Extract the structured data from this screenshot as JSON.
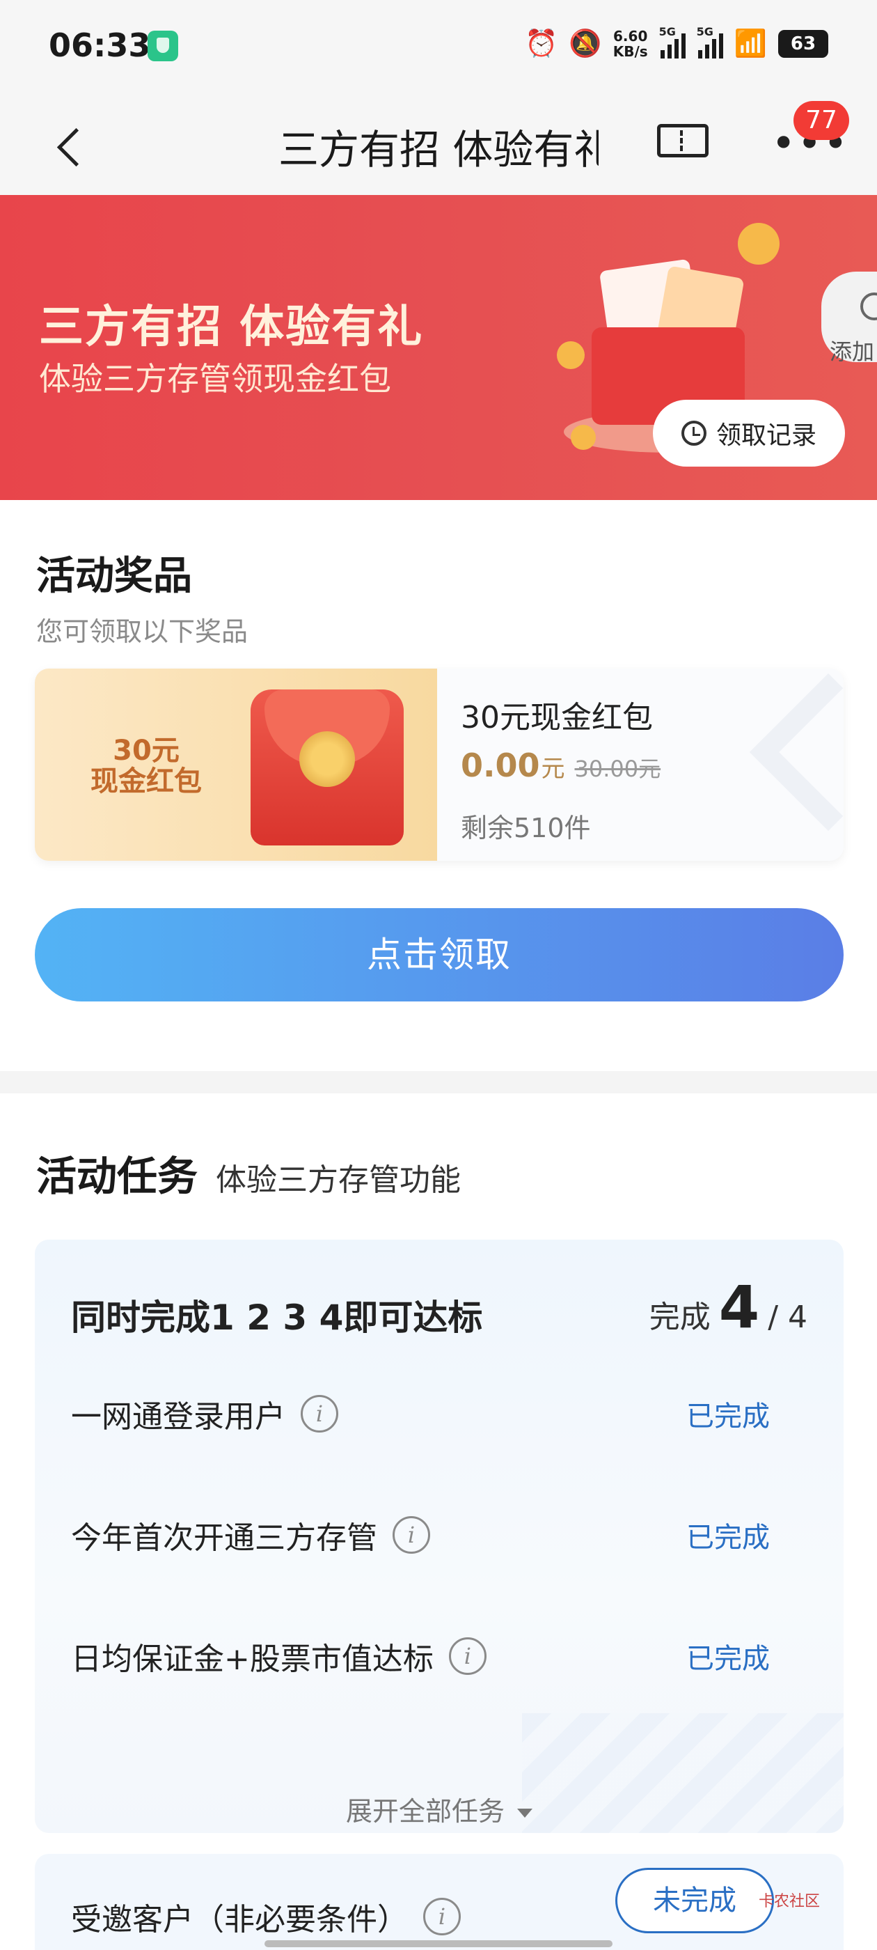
{
  "status_bar": {
    "time": "06:33",
    "speed_value": "6.60",
    "speed_unit": "KB/s",
    "sig1_label": "5G",
    "sig2_label": "5G",
    "battery": "63",
    "icons": [
      "alarm-icon",
      "mute-icon",
      "signal-icon",
      "signal-icon",
      "wifi-icon",
      "battery-icon"
    ]
  },
  "header": {
    "title": "三方有招 体验有礼",
    "badge_count": "77"
  },
  "banner": {
    "title": "三方有招 体验有礼",
    "subtitle": "体验三方存管领现金红包",
    "add_label": "添加",
    "record_label": "领取记录"
  },
  "prizes": {
    "title": "活动奖品",
    "subtitle": "您可领取以下奖品",
    "items": [
      {
        "thumb_line1": "30元",
        "thumb_line2": "现金红包",
        "name": "30元现金红包",
        "price": "0.00",
        "price_unit": "元",
        "original_price": "30.00元",
        "stock": "剩余510件"
      }
    ],
    "claim_label": "点击领取"
  },
  "tasks": {
    "title": "活动任务",
    "subtitle": "体验三方存管功能",
    "card_title": "同时完成1 2 3 4即可达标",
    "progress_label": "完成",
    "progress_done": "4",
    "progress_sep": "/ 4",
    "items": [
      {
        "label": "一网通登录用户",
        "status": "已完成"
      },
      {
        "label": "今年首次开通三方存管",
        "status": "已完成"
      },
      {
        "label": "日均保证金+股票市值达标",
        "status": "已完成"
      }
    ],
    "expand_label": "展开全部任务",
    "invite": {
      "label": "受邀客户（非必要条件）",
      "status": "未完成"
    },
    "watermark": "卡农社区"
  },
  "colors": {
    "banner_red": "#e64f52",
    "claim_gradient_start": "#53b3f5",
    "claim_gradient_end": "#5a7ee6",
    "status_blue": "#2a6fc4",
    "price_gold": "#b5884c",
    "badge_red": "#f23b35"
  }
}
